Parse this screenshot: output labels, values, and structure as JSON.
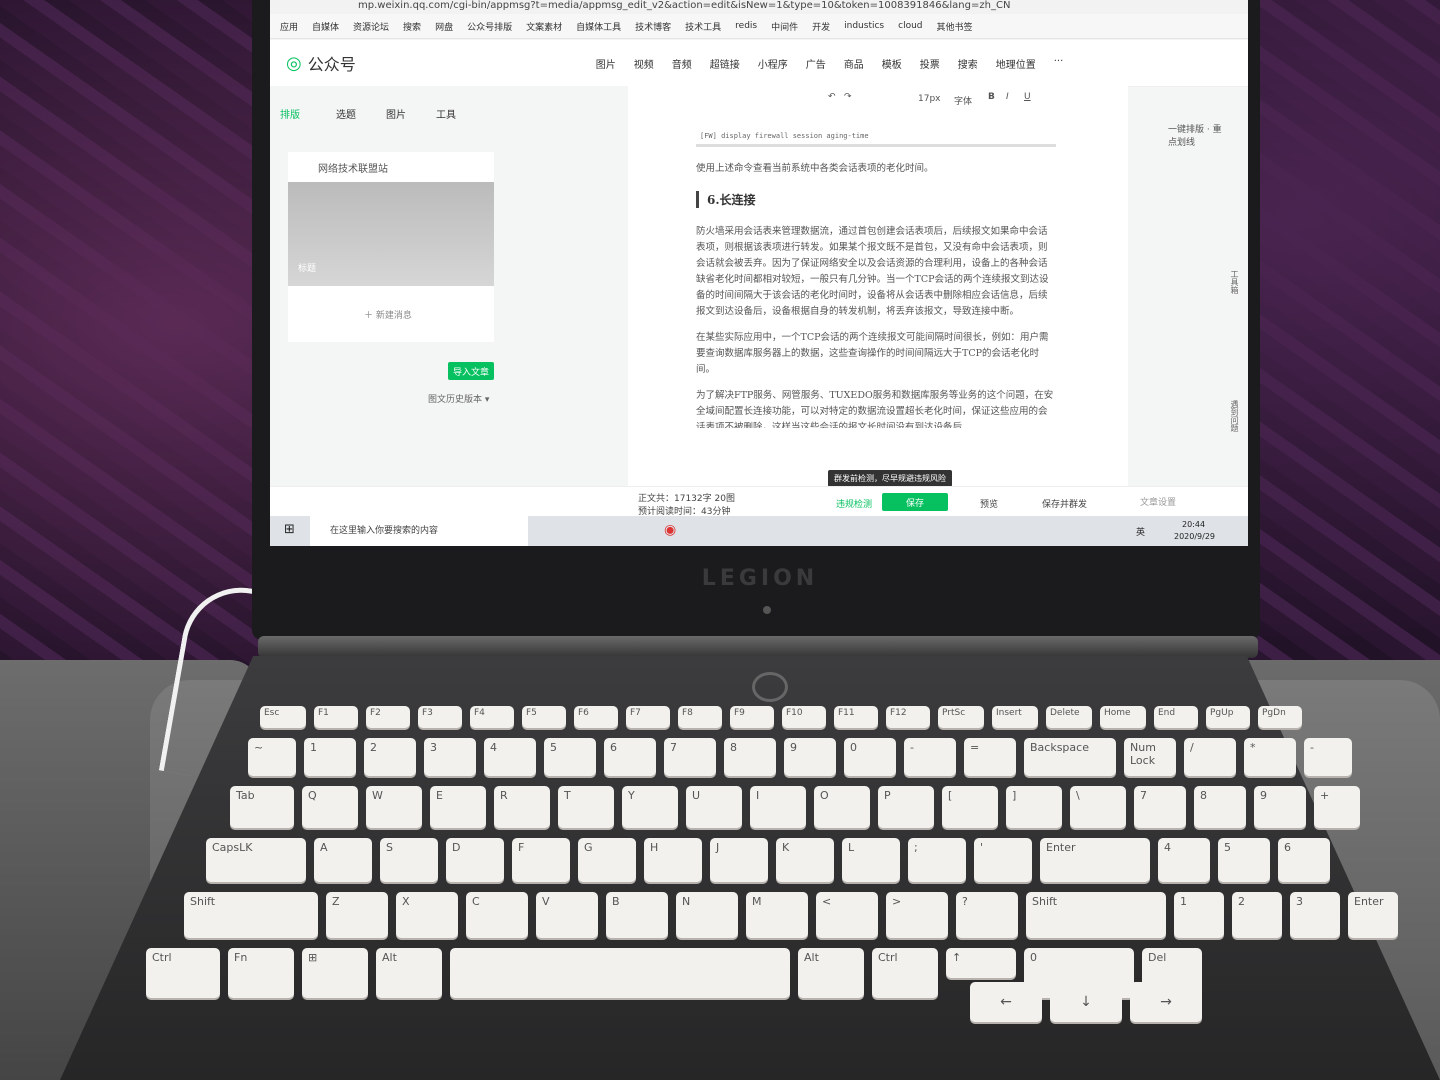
{
  "browser": {
    "url": "mp.weixin.qq.com/cgi-bin/appmsg?t=media/appmsg_edit_v2&action=edit&isNew=1&type=10&token=1008391846&lang=zh_CN",
    "bookmarks": [
      "应用",
      "自媒体",
      "资源论坛",
      "搜索",
      "网盘",
      "公众号排版",
      "文案素材",
      "自媒体工具",
      "技术博客",
      "技术工具",
      "redis",
      "中间件",
      "开发",
      "industics",
      "cloud",
      "其他书签"
    ]
  },
  "app": {
    "brand": "公众号",
    "nav": [
      "图片",
      "视频",
      "音频",
      "超链接",
      "小程序",
      "广告",
      "商品",
      "模板",
      "投票",
      "搜索",
      "地理位置",
      "···"
    ]
  },
  "sidebar": {
    "tabs": [
      "排版",
      "选题",
      "图片",
      "工具"
    ],
    "account_name": "网络技术联盟站",
    "thumb_label": "标题",
    "new_message": "＋ 新建消息",
    "import_button": "导入文章",
    "history": "图文历史版本 ▾"
  },
  "toolbar": {
    "font_size": "17px",
    "font": "字体",
    "row2": "一键排版 · 重点划线"
  },
  "editor": {
    "code_line": "[FW] display firewall session aging-time",
    "p0": "使用上述命令查看当前系统中各类会话表项的老化时间。",
    "heading": "6.长连接",
    "p1": "防火墙采用会话表来管理数据流，通过首包创建会话表项后，后续报文如果命中会话表项，则根据该表项进行转发。如果某个报文既不是首包，又没有命中会话表项，则会话就会被丢弃。因为了保证网络安全以及会话资源的合理利用，设备上的各种会话缺省老化时间都相对较短，一般只有几分钟。当一个TCP会话的两个连续报文到达设备的时间间隔大于该会话的老化时间时，设备将从会话表中删除相应会话信息，后续报文到达设备后，设备根据自身的转发机制，将丢弃该报文，导致连接中断。",
    "p2": "在某些实际应用中，一个TCP会话的两个连续报文可能间隔时间很长，例如：用户需要查询数据库服务器上的数据，这些查询操作的时间间隔远大于TCP的会话老化时间。",
    "p3": "为了解决FTP服务、网管服务、TUXEDO服务和数据库服务等业务的这个问题，在安全域间配置长连接功能，可以对特定的数据流设置超长老化时间，保证这些应用的会话表项不被删除，这样当这些会话的报文长时间没有到达设备后"
  },
  "status": {
    "word_count": "正文共：17132字 20图",
    "read_time": "预计阅读时间：43分钟",
    "check": "违规检测",
    "save": "保存",
    "preview": "预览",
    "save_send": "保存并群发",
    "settings": "文章设置",
    "tooltip": "群发前检测，尽早规避违规风险"
  },
  "right_rail": {
    "tools": "工具箱",
    "help": "遇到问题"
  },
  "taskbar": {
    "search": "在这里输入你要搜索的内容",
    "lang": "英",
    "time": "20:44",
    "date": "2020/9/29"
  },
  "laptop": {
    "brand": "LEGION"
  },
  "keyboard": {
    "row0": [
      "Esc",
      "F1",
      "F2",
      "F3",
      "F4",
      "F5",
      "F6",
      "F7",
      "F8",
      "F9",
      "F10",
      "F11",
      "F12",
      "PrtSc",
      "Insert",
      "Delete",
      "Home",
      "End",
      "PgUp",
      "PgDn"
    ],
    "row1": [
      "~",
      "1",
      "2",
      "3",
      "4",
      "5",
      "6",
      "7",
      "8",
      "9",
      "0",
      "-",
      "=",
      "Backspace",
      "Num Lock",
      "/",
      "*",
      "-"
    ],
    "row2": [
      "Tab",
      "Q",
      "W",
      "E",
      "R",
      "T",
      "Y",
      "U",
      "I",
      "O",
      "P",
      "[",
      "]",
      "\\",
      "7",
      "8",
      "9",
      "+"
    ],
    "row3": [
      "CapsLK",
      "A",
      "S",
      "D",
      "F",
      "G",
      "H",
      "J",
      "K",
      "L",
      ";",
      "'",
      "Enter",
      "4",
      "5",
      "6"
    ],
    "row4": [
      "Shift",
      "Z",
      "X",
      "C",
      "V",
      "B",
      "N",
      "M",
      "<",
      ">",
      "?",
      "Shift",
      "1",
      "2",
      "3",
      "Enter"
    ],
    "row5": [
      "Ctrl",
      "Fn",
      "⊞",
      "Alt",
      "",
      "Alt",
      "Ctrl",
      "↑",
      "0",
      "Del"
    ],
    "arrows": [
      "←",
      "↓",
      "→"
    ]
  }
}
